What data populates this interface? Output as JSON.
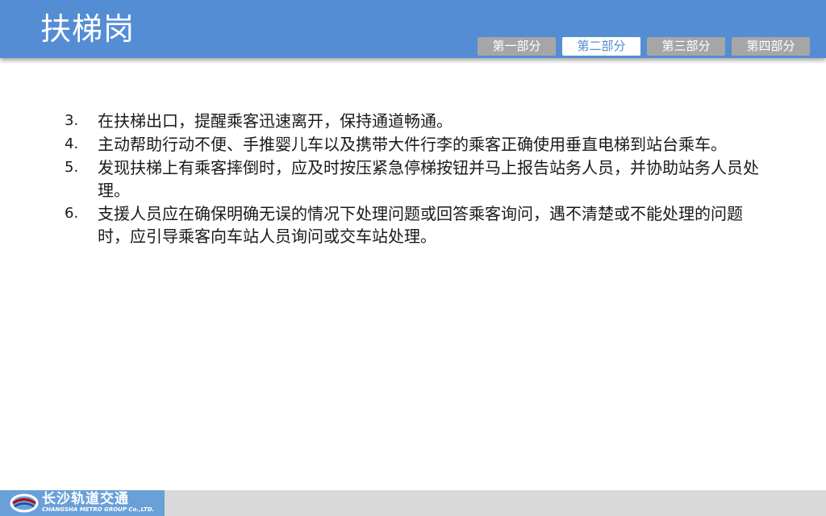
{
  "header": {
    "title": "扶梯岗",
    "tabs": [
      {
        "label": "第一部分",
        "active": false
      },
      {
        "label": "第二部分",
        "active": true
      },
      {
        "label": "第三部分",
        "active": false
      },
      {
        "label": "第四部分",
        "active": false
      }
    ]
  },
  "content": {
    "items": [
      {
        "num": "3.",
        "text": "在扶梯出口，提醒乘客迅速离开，保持通道畅通。"
      },
      {
        "num": "4.",
        "text": "主动帮助行动不便、手推婴儿车以及携带大件行李的乘客正确使用垂直电梯到站台乘车。"
      },
      {
        "num": "5.",
        "text": "发现扶梯上有乘客摔倒时，应及时按压紧急停梯按钮并马上报告站务人员，并协助站务人员处理。"
      },
      {
        "num": "6.",
        "text": "支援人员应在确保明确无误的情况下处理问题或回答乘客询问，遇不清楚或不能处理的问题时，应引导乘客向车站人员询问或交车站处理。"
      }
    ]
  },
  "footer": {
    "logo_cn": "长沙轨道交通",
    "logo_en": "CHANGSHA METRO GROUP Co.,LTD."
  },
  "colors": {
    "header_bg": "#548dd4",
    "tab_inactive": "#a6a6a6",
    "tab_active_text": "#548dd4",
    "footer_bg": "#d9d9d9",
    "logo_bg": "#6aa0d8"
  }
}
